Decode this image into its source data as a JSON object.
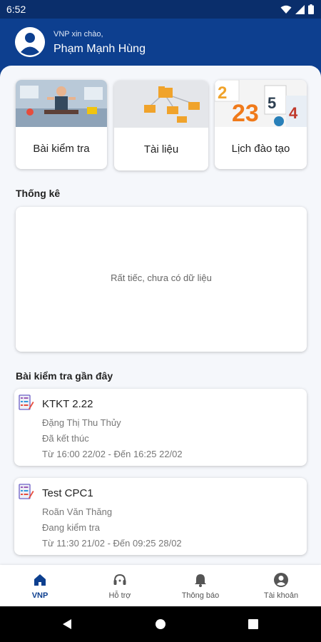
{
  "status": {
    "time": "6:52"
  },
  "header": {
    "greeting": "VNP xin chào,",
    "user_name": "Phạm Mạnh Hùng"
  },
  "quick_links": [
    {
      "label": "Bài kiểm tra",
      "icon": "exam-illustration"
    },
    {
      "label": "Tài liệu",
      "icon": "documents-illustration"
    },
    {
      "label": "Lịch đào tạo",
      "icon": "calendar-illustration"
    }
  ],
  "stats": {
    "title": "Thống kê",
    "empty_message": "Rất tiếc, chưa có dữ liệu"
  },
  "recent": {
    "title": "Bài kiểm tra gần đây",
    "items": [
      {
        "title": "KTKT 2.22",
        "author": "Đặng Thị Thu Thủy",
        "status": "Đã kết thúc",
        "time": "Từ 16:00 22/02 - Đến 16:25 22/02"
      },
      {
        "title": "Test CPC1",
        "author": "Roãn Văn Thăng",
        "status": "Đang kiểm tra",
        "time": "Từ 11:30 21/02 - Đến 09:25 28/02"
      }
    ]
  },
  "nav": [
    {
      "label": "VNP",
      "icon": "home-icon",
      "active": true
    },
    {
      "label": "Hỗ trợ",
      "icon": "support-icon",
      "active": false
    },
    {
      "label": "Thông báo",
      "icon": "bell-icon",
      "active": false
    },
    {
      "label": "Tài khoản",
      "icon": "account-icon",
      "active": false
    }
  ],
  "colors": {
    "primary": "#0d3f8f",
    "status_bar": "#0a2e6b",
    "background": "#f5f7fb"
  }
}
